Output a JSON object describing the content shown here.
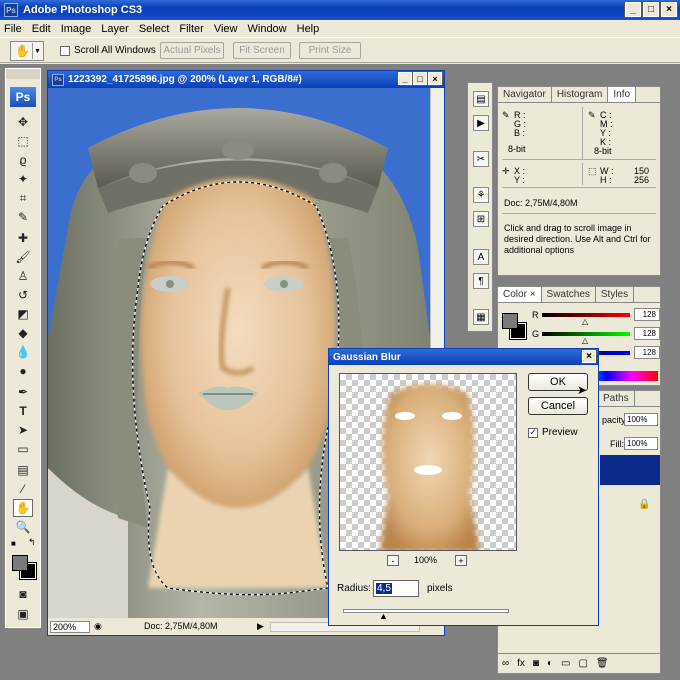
{
  "app": {
    "title": "Adobe Photoshop CS3",
    "logo": "Ps"
  },
  "menu": [
    "File",
    "Edit",
    "Image",
    "Layer",
    "Select",
    "Filter",
    "View",
    "Window",
    "Help"
  ],
  "options": {
    "scroll_all": "Scroll All Windows",
    "actual_pixels": "Actual Pixels",
    "fit_screen": "Fit Screen",
    "print_size": "Print Size"
  },
  "document": {
    "title": "1223392_41725896.jpg @ 200% (Layer 1, RGB/8#)",
    "zoom": "200%",
    "doc_size": "Doc: 2,75M/4,80M"
  },
  "navigator_panel": {
    "tabs": [
      "Navigator",
      "Histogram",
      "Info"
    ],
    "active_tab": "Info",
    "rgb_labels": [
      "R :",
      "G :",
      "B :"
    ],
    "rgb_depth": "8-bit",
    "cmyk_labels": [
      "C :",
      "M :",
      "Y :",
      "K :"
    ],
    "cmyk_depth": "8-bit",
    "xy_labels": [
      "X :",
      "Y :"
    ],
    "wh_labels": [
      "W :",
      "H :"
    ],
    "w_value": "150",
    "h_value": "256",
    "doc": "Doc: 2,75M/4,80M",
    "hint": "Click and drag to scroll image in desired direction.  Use Alt and Ctrl for additional options"
  },
  "color_panel": {
    "tabs": [
      "Color",
      "Swatches",
      "Styles"
    ],
    "active_tab": "Color",
    "channels": [
      {
        "label": "R",
        "value": "128"
      },
      {
        "label": "G",
        "value": "128"
      },
      {
        "label": "B",
        "value": "128"
      }
    ]
  },
  "layers_panel": {
    "tab": "Paths",
    "opacity_label": "pacity:",
    "opacity_value": "100%",
    "fill_label": "Fill:",
    "fill_value": "100%"
  },
  "dialog": {
    "title": "Gaussian Blur",
    "ok": "OK",
    "cancel": "Cancel",
    "preview_label": "Preview",
    "preview_checked": true,
    "zoom": "100%",
    "radius_label": "Radius:",
    "radius_value": "4,5",
    "radius_unit": "pixels",
    "minus": "-",
    "plus": "+"
  },
  "colors": {
    "title_blue": "#0a3fb8",
    "sky": "#3a6fd0",
    "skin": "#e8c8a0",
    "foreground": "#7a7a7a",
    "background": "#000000"
  }
}
